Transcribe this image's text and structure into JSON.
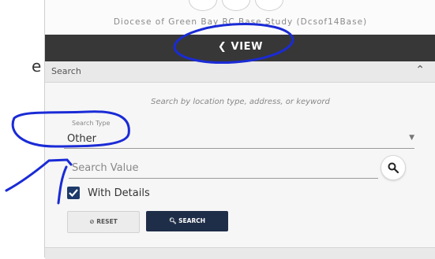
{
  "window": {
    "title": "Diocese of Green Bay RC Base Study (Dcsof14Base)"
  },
  "toolbar": {
    "view_label": "VIEW",
    "view_icon": "chevron-left-icon"
  },
  "search_section": {
    "title": "Search",
    "hint": "Search by location type, address, or keyword",
    "search_type": {
      "label": "Search Type",
      "value": "Other"
    },
    "search_value": {
      "placeholder": "Search Value",
      "value": ""
    },
    "with_details": {
      "label": "With Details",
      "checked": true
    },
    "reset_label": "RESET",
    "search_label": "SEARCH"
  },
  "left_fragments": [
    "e"
  ],
  "colors": {
    "view_bar": "#373737",
    "primary_button": "#1f2e48",
    "checkbox": "#1d3a6b",
    "annotation": "#1a2bd6"
  }
}
